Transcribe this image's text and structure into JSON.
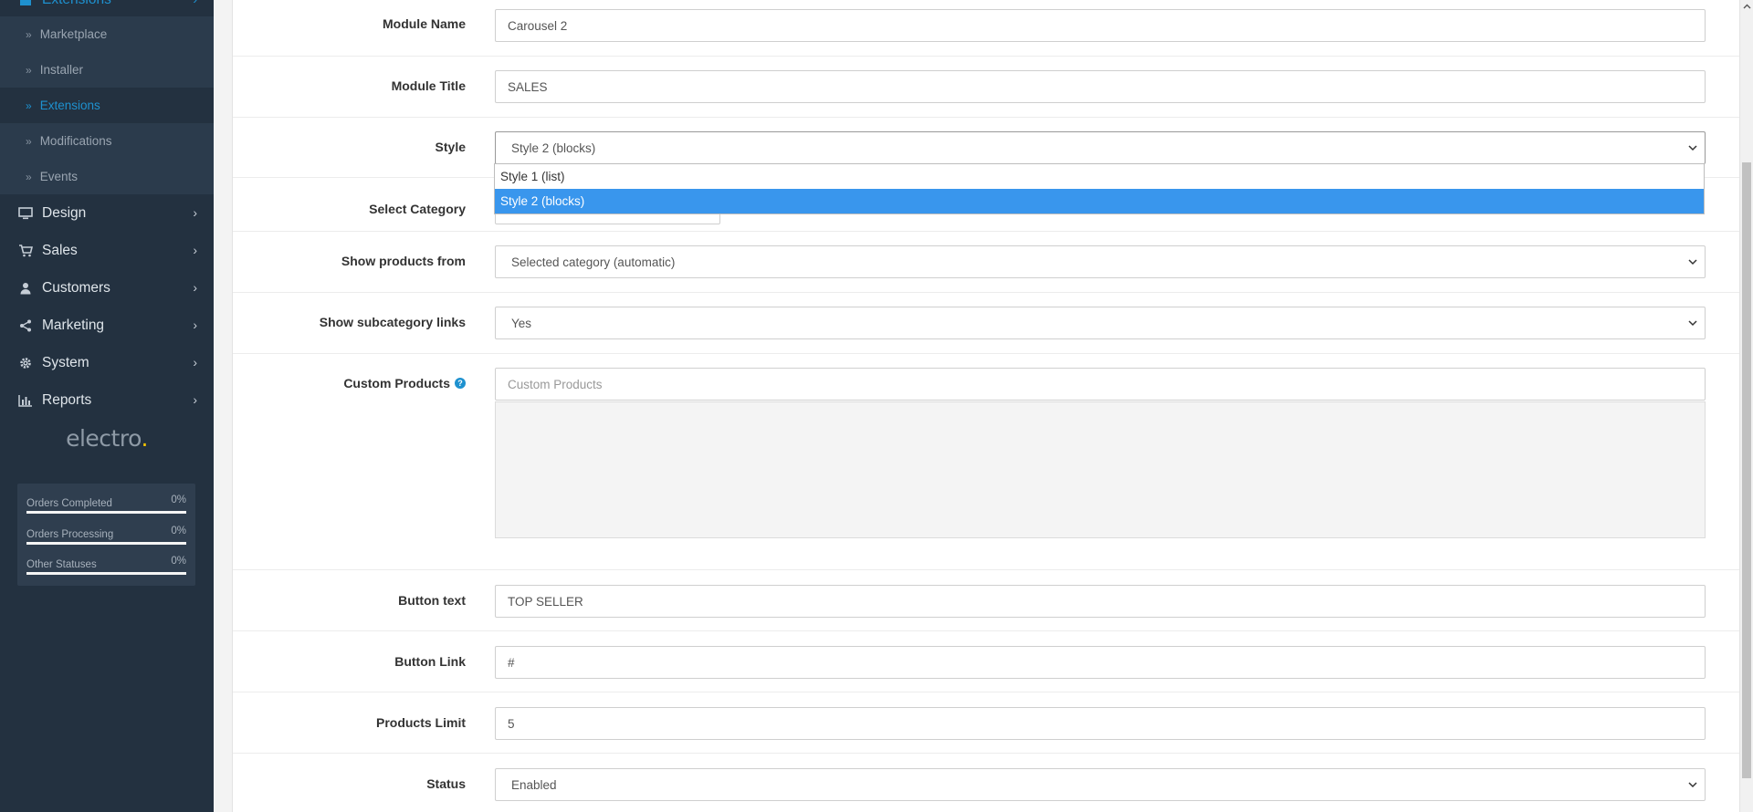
{
  "sidebar": {
    "top_partial": "Extensions",
    "sub_items": [
      {
        "label": "Marketplace",
        "active": false
      },
      {
        "label": "Installer",
        "active": false
      },
      {
        "label": "Extensions",
        "active": true
      },
      {
        "label": "Modifications",
        "active": false
      },
      {
        "label": "Events",
        "active": false
      }
    ],
    "main_items": [
      {
        "label": "Design",
        "icon": "monitor-icon"
      },
      {
        "label": "Sales",
        "icon": "cart-icon"
      },
      {
        "label": "Customers",
        "icon": "user-icon"
      },
      {
        "label": "Marketing",
        "icon": "share-icon"
      },
      {
        "label": "System",
        "icon": "gear-icon"
      },
      {
        "label": "Reports",
        "icon": "bar-chart-icon"
      }
    ],
    "logo_text": "electro",
    "logo_dot": ".",
    "stats": [
      {
        "label": "Orders Completed",
        "percent": "0%"
      },
      {
        "label": "Orders Processing",
        "percent": "0%"
      },
      {
        "label": "Other Statuses",
        "percent": "0%"
      }
    ]
  },
  "form": {
    "module_name": {
      "label": "Module Name",
      "value": "Carousel 2"
    },
    "module_title": {
      "label": "Module Title",
      "value": "SALES"
    },
    "style": {
      "label": "Style",
      "value": "Style 2 (blocks)",
      "options": [
        "Style 1 (list)",
        "Style 2 (blocks)"
      ]
    },
    "select_category": {
      "label": "Select Category"
    },
    "show_products_from": {
      "label": "Show products from",
      "value": "Selected category (automatic)"
    },
    "show_subcategory_links": {
      "label": "Show subcategory links",
      "value": "Yes"
    },
    "custom_products": {
      "label": "Custom Products",
      "placeholder": "Custom Products",
      "help": "?"
    },
    "button_text": {
      "label": "Button text",
      "value": "TOP SELLER"
    },
    "button_link": {
      "label": "Button Link",
      "value": "#"
    },
    "products_limit": {
      "label": "Products Limit",
      "value": "5"
    },
    "status": {
      "label": "Status",
      "value": "Enabled"
    }
  },
  "colors": {
    "sidebar_bg": "#233140",
    "accent": "#1e91cf",
    "dropdown_selected": "#3996ed",
    "logo_dot": "#f5c400"
  }
}
